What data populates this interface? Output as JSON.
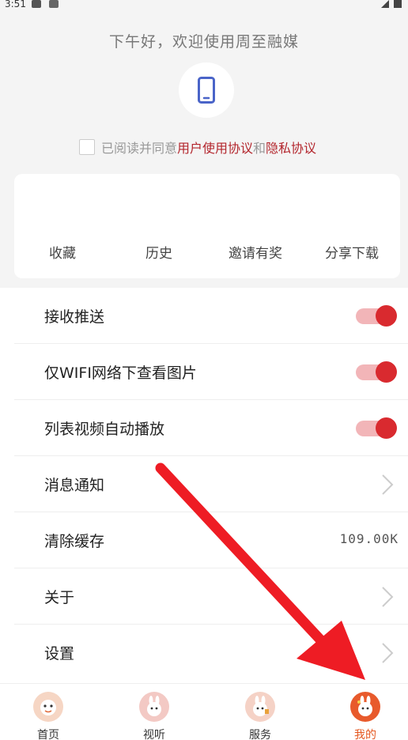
{
  "status": {
    "time": "3:51"
  },
  "header": {
    "greeting": "下午好，欢迎使用周至融媒",
    "agree_prefix": "已阅读并同意",
    "user_agreement": "用户使用协议",
    "and_text": "和",
    "privacy_agreement": "隐私协议"
  },
  "quick": {
    "items": [
      {
        "label": "收藏"
      },
      {
        "label": "历史"
      },
      {
        "label": "邀请有奖"
      },
      {
        "label": "分享下载"
      }
    ]
  },
  "settings": {
    "push": {
      "label": "接收推送",
      "enabled": true
    },
    "wifi_images": {
      "label": "仅WIFI网络下查看图片",
      "enabled": true
    },
    "autoplay": {
      "label": "列表视频自动播放",
      "enabled": true
    },
    "notifications": {
      "label": "消息通知"
    },
    "cache": {
      "label": "清除缓存",
      "value": "109.00K"
    },
    "about": {
      "label": "关于"
    },
    "settings": {
      "label": "设置"
    }
  },
  "tabs": [
    {
      "label": "首页",
      "active": false
    },
    {
      "label": "视听",
      "active": false
    },
    {
      "label": "服务",
      "active": false
    },
    {
      "label": "我的",
      "active": true
    }
  ],
  "colors": {
    "accent": "#d92a2f",
    "link": "#b3262d",
    "active_tab": "#e4571f"
  }
}
